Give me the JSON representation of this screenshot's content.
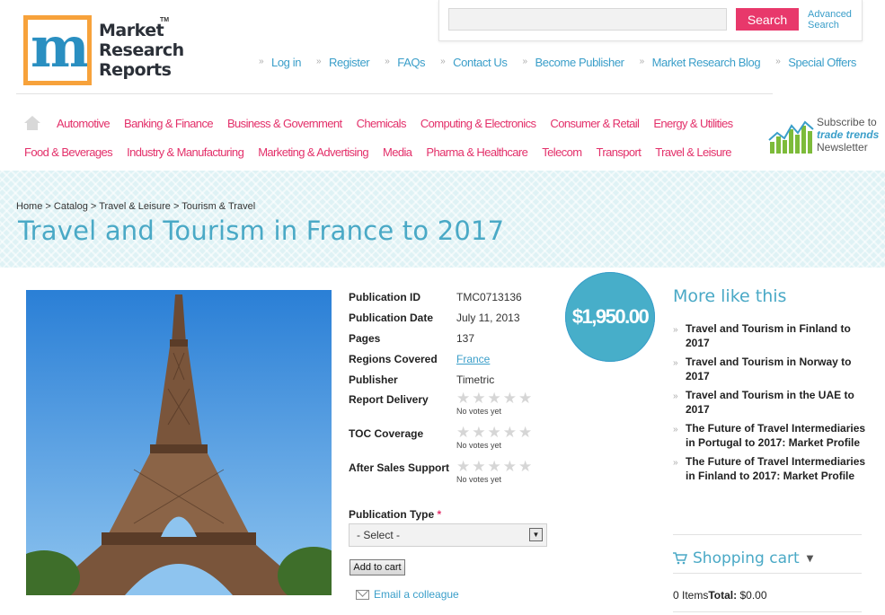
{
  "logo": {
    "line1": "Market",
    "line2": "Research",
    "line3": "Reports",
    "tm": "TM"
  },
  "search": {
    "placeholder": "",
    "button_label": "Search",
    "advanced_line1": "Advanced",
    "advanced_line2": "Search"
  },
  "top_links": [
    "Log in",
    "Register",
    "FAQs",
    "Contact Us",
    "Become Publisher",
    "Market Research Blog",
    "Special Offers"
  ],
  "categories_row1": [
    "Automotive",
    "Banking & Finance",
    "Business & Government",
    "Chemicals",
    "Computing & Electronics",
    "Consumer & Retail",
    "Energy & Utilities"
  ],
  "categories_row2": [
    "Food & Beverages",
    "Industry & Manufacturing",
    "Marketing & Advertising",
    "Media",
    "Pharma & Healthcare",
    "Telecom",
    "Transport",
    "Travel & Leisure"
  ],
  "newsletter": {
    "line1": "Subscribe to",
    "line2": "trade trends",
    "line3": "Newsletter"
  },
  "breadcrumb": {
    "home": "Home",
    "catalog": "Catalog",
    "category": "Travel & Leisure",
    "current": "Tourism & Travel",
    "sep": ">"
  },
  "page_title": "Travel and Tourism in France to 2017",
  "details": {
    "publication_id_label": "Publication ID",
    "publication_id": "TMC0713136",
    "publication_date_label": "Publication Date",
    "publication_date": "July 11, 2013",
    "pages_label": "Pages",
    "pages": "137",
    "regions_label": "Regions Covered",
    "regions": "France",
    "publisher_label": "Publisher",
    "publisher": "Timetric"
  },
  "ratings": [
    {
      "label": "Report Delivery",
      "votes": "No votes yet",
      "stars": 0
    },
    {
      "label": "TOC Coverage",
      "votes": "No votes yet",
      "stars": 0
    },
    {
      "label": "After Sales Support",
      "votes": "No votes yet",
      "stars": 0
    }
  ],
  "publication_type": {
    "label": "Publication Type",
    "required": "*",
    "selected": "- Select -"
  },
  "add_to_cart": "Add to cart",
  "email_colleague": "Email a colleague",
  "price": "$1,950.00",
  "more_like_this": {
    "title": "More like this",
    "items": [
      "Travel and Tourism in Finland to 2017",
      "Travel and Tourism in Norway to 2017",
      "Travel and Tourism in the UAE to 2017",
      "The Future of Travel Intermediaries in Portugal to 2017: Market Profile",
      "The Future of Travel Intermediaries in Finland to 2017: Market Profile"
    ]
  },
  "cart": {
    "title": "Shopping cart",
    "items": "0 Items",
    "total_label": "Total:",
    "total": "$0.00"
  },
  "colors": {
    "accent_blue": "#4aa9c6",
    "category_pink": "#e3306a",
    "search_button": "#e8386b",
    "logo_orange": "#f7a23b"
  }
}
